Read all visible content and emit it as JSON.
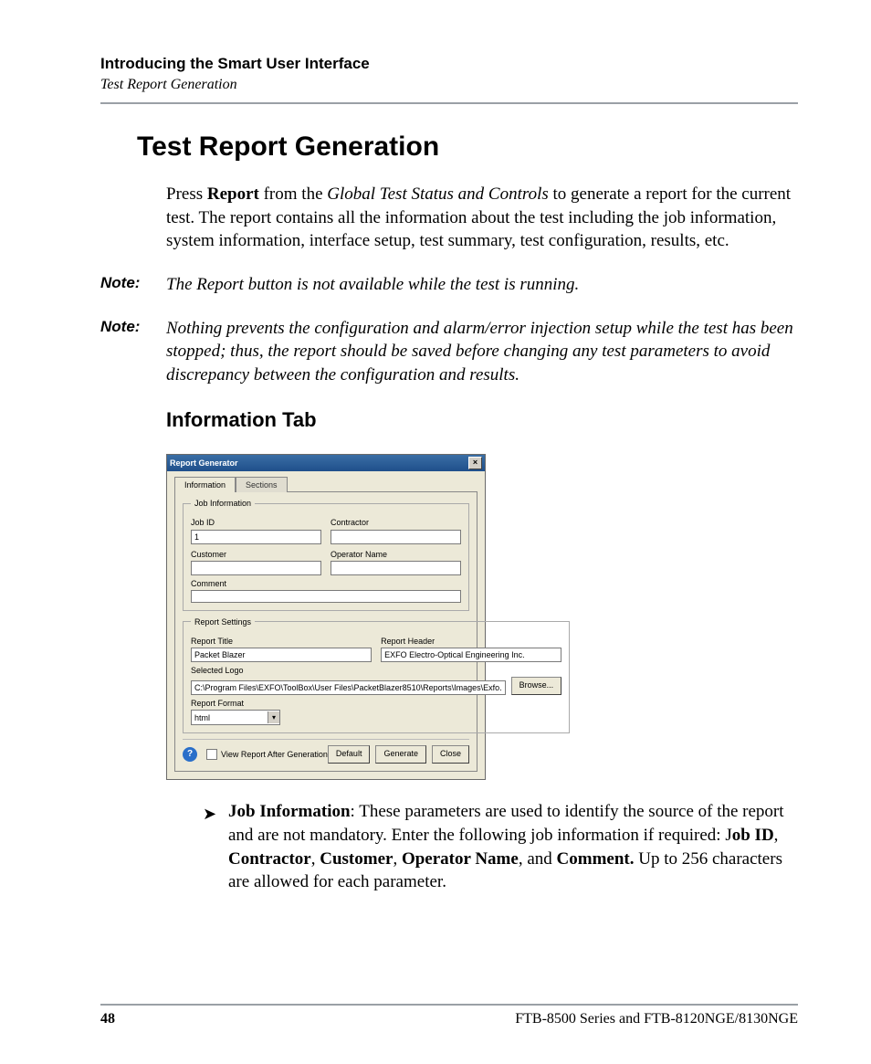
{
  "header": {
    "chapter": "Introducing the Smart User Interface",
    "breadcrumb": "Test Report Generation"
  },
  "headings": {
    "main": "Test Report Generation",
    "sub": "Information Tab"
  },
  "intro": {
    "pre": "Press ",
    "bold1": "Report",
    "mid1": " from the ",
    "ital1": "Global Test Status and Controls",
    "post": " to generate a report for the current test. The report contains all the information about the test including the job information, system information, interface setup, test summary, test configuration, results, etc."
  },
  "notes": {
    "label": "Note:",
    "n1": "The Report button is not available while the test is running.",
    "n2": "Nothing prevents the configuration and alarm/error injection setup while the test has been stopped; thus, the report should be saved before changing any test parameters to avoid discrepancy between the configuration and results."
  },
  "dialog": {
    "title": "Report Generator",
    "close": "×",
    "tabs": {
      "info": "Information",
      "sections": "Sections"
    },
    "group1": {
      "legend": "Job Information",
      "jobid_label": "Job ID",
      "jobid_value": "1",
      "contractor_label": "Contractor",
      "contractor_value": "",
      "customer_label": "Customer",
      "customer_value": "",
      "operator_label": "Operator Name",
      "operator_value": "",
      "comment_label": "Comment",
      "comment_value": ""
    },
    "group2": {
      "legend": "Report Settings",
      "title_label": "Report Title",
      "title_value": "Packet Blazer",
      "header_label": "Report Header",
      "header_value": "EXFO Electro-Optical Engineering Inc.",
      "logo_label": "Selected Logo",
      "logo_value": "C:\\Program Files\\EXFO\\ToolBox\\User Files\\PacketBlazer8510\\Reports\\Images\\Exfo.",
      "browse": "Browse...",
      "format_label": "Report Format",
      "format_value": "html",
      "drop": "▾"
    },
    "bottom": {
      "help": "?",
      "view_after": "View Report After Generation",
      "default": "Default",
      "generate": "Generate",
      "close": "Close"
    }
  },
  "bullet": {
    "arrow": "➤",
    "b1": "Job Information",
    "t1": ": These parameters are used to identify the source of the report and are not mandatory. Enter the following job information if required: J",
    "b2": "ob ID",
    "c1": ", ",
    "b3": "Contractor",
    "c2": ", ",
    "b4": "Customer",
    "c3": ", ",
    "b5": "Operator Name",
    "c4": ", and ",
    "b6": "Comment.",
    "t2": " Up to 256 characters are allowed for each parameter."
  },
  "footer": {
    "page": "48",
    "right": "FTB-8500 Series and FTB-8120NGE/8130NGE"
  }
}
